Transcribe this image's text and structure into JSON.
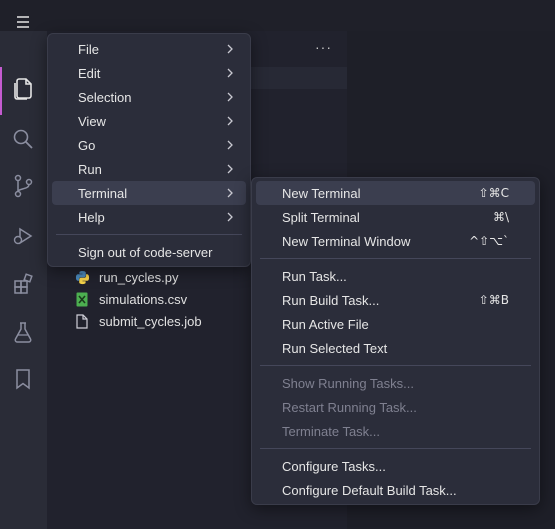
{
  "main_menu": {
    "items": [
      {
        "label": "File"
      },
      {
        "label": "Edit"
      },
      {
        "label": "Selection"
      },
      {
        "label": "View"
      },
      {
        "label": "Go"
      },
      {
        "label": "Run"
      },
      {
        "label": "Terminal"
      },
      {
        "label": "Help"
      }
    ],
    "sign_out": "Sign out of code-server"
  },
  "terminal_menu": {
    "new_terminal": {
      "label": "New Terminal",
      "key": "⇧⌘C"
    },
    "split_terminal": {
      "label": "Split Terminal",
      "key": "⌘\\"
    },
    "new_terminal_window": {
      "label": "New Terminal Window",
      "key": "^⇧⌥`"
    },
    "run_task": {
      "label": "Run Task..."
    },
    "run_build_task": {
      "label": "Run Build Task...",
      "key": "⇧⌘B"
    },
    "run_active_file": {
      "label": "Run Active File"
    },
    "run_selected_text": {
      "label": "Run Selected Text"
    },
    "show_running_tasks": {
      "label": "Show Running Tasks..."
    },
    "restart_running_task": {
      "label": "Restart Running Task..."
    },
    "terminate_task": {
      "label": "Terminate Task..."
    },
    "configure_tasks": {
      "label": "Configure Tasks..."
    },
    "configure_default_build_task": {
      "label": "Configure Default Build Task..."
    }
  },
  "explorer": {
    "files": [
      {
        "name": "run_cycles.py",
        "icon": "python-icon"
      },
      {
        "name": "simulations.csv",
        "icon": "csv-icon"
      },
      {
        "name": "submit_cycles.job",
        "icon": "file-icon"
      }
    ],
    "more_actions": "···"
  },
  "colors": {
    "accent": "#c45bd0",
    "menu_bg": "#2b2d3a",
    "highlight": "#3b3e4f",
    "disabled_text": "#7f8090"
  }
}
